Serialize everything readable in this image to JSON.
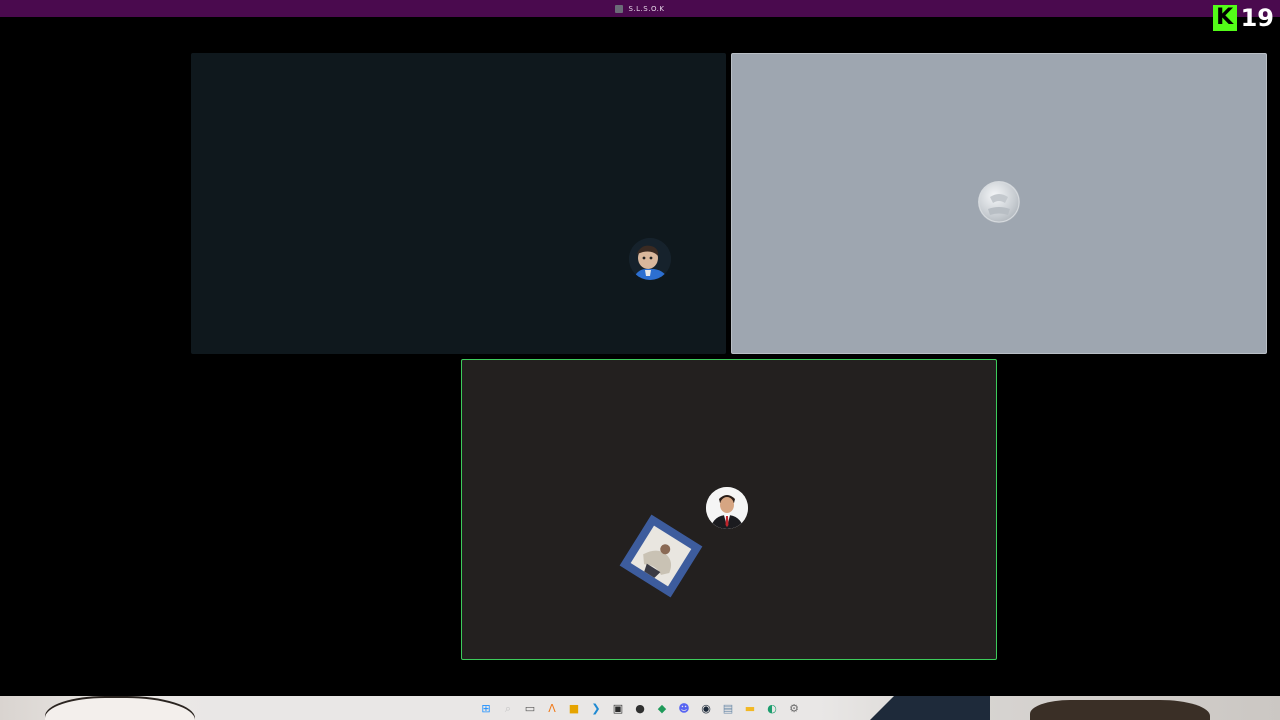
{
  "window": {
    "title": "S.L.S.O.K"
  },
  "kick_overlay": {
    "logo_letter": "K",
    "count": "19",
    "accent": "#53fc18"
  },
  "participants": [
    {
      "id": "tile-a",
      "background": "#0f181d",
      "avatar": "boy-in-blue-avatar"
    },
    {
      "id": "tile-b",
      "background": "#9ea6b0",
      "avatar": "default-grey-avatar"
    },
    {
      "id": "tile-c",
      "background": "#23201f",
      "avatar": "man-in-suit-avatar",
      "speaking": true,
      "speaking_border": "#3ccb5b"
    }
  ],
  "taskbar": {
    "icons": [
      {
        "name": "windows-start-icon",
        "glyph": "⊞",
        "color": "#1e90ff"
      },
      {
        "name": "search-icon",
        "glyph": "⌕",
        "color": "#c5c5c5"
      },
      {
        "name": "task-view-icon",
        "glyph": "▭",
        "color": "#555555"
      },
      {
        "name": "triangle-app-icon",
        "glyph": "Λ",
        "color": "#f07a1a"
      },
      {
        "name": "yellow-app-icon",
        "glyph": "■",
        "color": "#e6a400"
      },
      {
        "name": "vscode-icon",
        "glyph": "❯",
        "color": "#1f8ad2"
      },
      {
        "name": "terminal-icon",
        "glyph": "▣",
        "color": "#2b2b2b"
      },
      {
        "name": "obs-icon",
        "glyph": "●",
        "color": "#303030"
      },
      {
        "name": "green-app-icon",
        "glyph": "◆",
        "color": "#1f9a5a"
      },
      {
        "name": "discord-icon",
        "glyph": "☻",
        "color": "#5865f2"
      },
      {
        "name": "steam-icon",
        "glyph": "◉",
        "color": "#1b2838"
      },
      {
        "name": "notepad-icon",
        "glyph": "▤",
        "color": "#6a8aa8"
      },
      {
        "name": "file-explorer-icon",
        "glyph": "▬",
        "color": "#f2b824"
      },
      {
        "name": "edge-icon",
        "glyph": "◐",
        "color": "#1c9e6e"
      },
      {
        "name": "settings-icon",
        "glyph": "⚙",
        "color": "#6a6a6a"
      }
    ]
  }
}
